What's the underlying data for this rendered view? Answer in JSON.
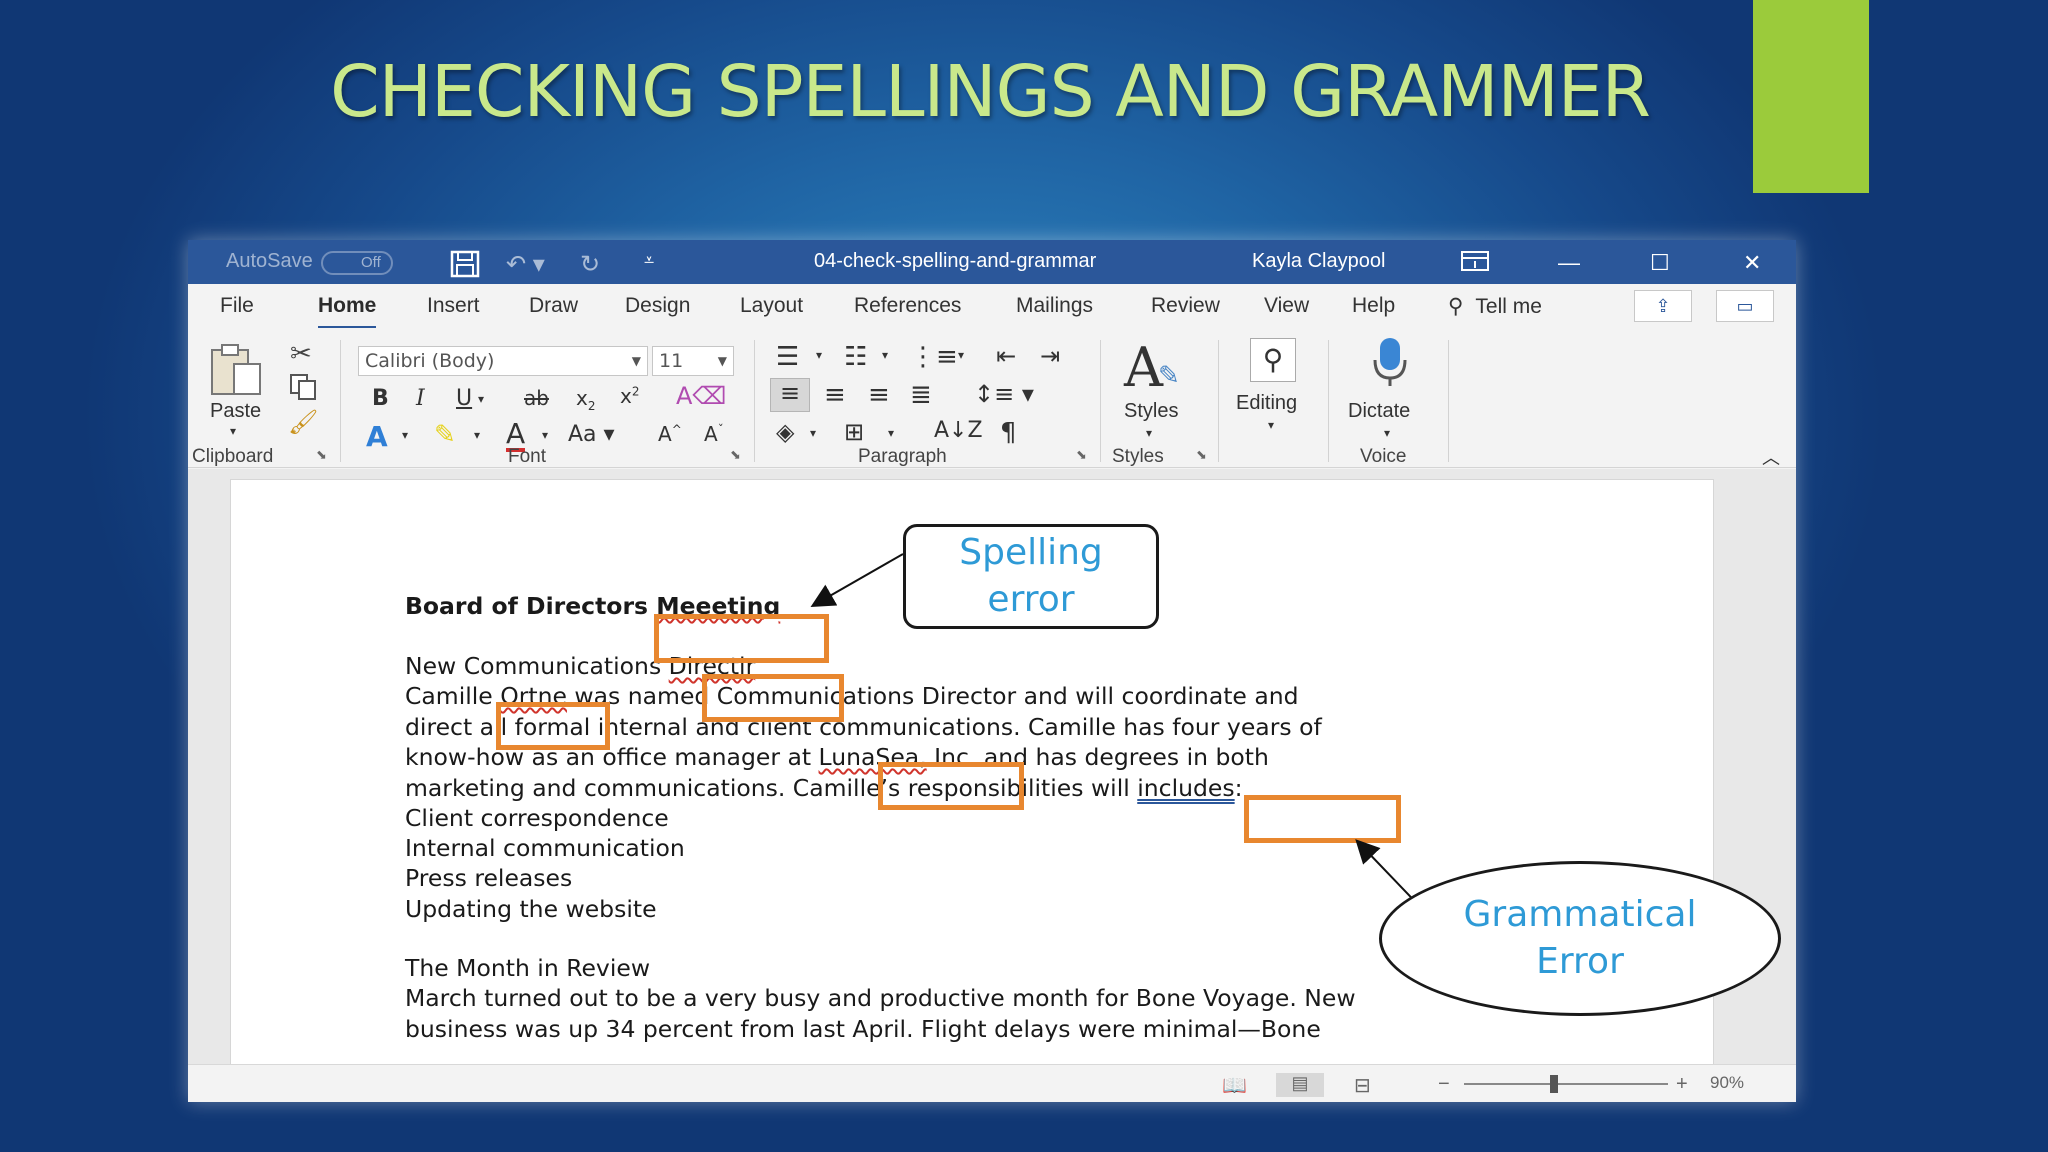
{
  "slide": {
    "title": "CHECKING SPELLINGS AND GRAMMER",
    "colors": {
      "title": "#c9e88b",
      "accent_bar": "#9bcb3b",
      "background": "#1f5fa0"
    }
  },
  "word": {
    "titlebar": {
      "autosave_label": "AutoSave",
      "autosave_state": "Off",
      "document_title": "04-check-spelling-and-grammar",
      "user_name": "Kayla Claypool"
    },
    "tabs": [
      "File",
      "Home",
      "Insert",
      "Draw",
      "Design",
      "Layout",
      "References",
      "Mailings",
      "Review",
      "View",
      "Help"
    ],
    "tell_me": "Tell me",
    "ribbon": {
      "clipboard": {
        "paste": "Paste",
        "group": "Clipboard"
      },
      "font": {
        "name": "Calibri (Body)",
        "size": "11",
        "case": "Aa",
        "group": "Font"
      },
      "paragraph": {
        "group": "Paragraph"
      },
      "styles": {
        "label": "Styles",
        "group": "Styles"
      },
      "editing": {
        "label": "Editing"
      },
      "voice": {
        "label": "Dictate",
        "group": "Voice"
      }
    },
    "document": {
      "heading_prefix": "Board of Director",
      "heading_error": "Meeeting",
      "sub_prefix": "New Communication",
      "sub_error": "Directir",
      "line1_a": "Camille ",
      "line1_error": "Ortne",
      "line1_b": " was named Communications Director and will coordinate and",
      "line2": "direct all formal internal and client communications. Camille has four years of",
      "line3_a": "know-how as an office manager at ",
      "line3_error": "LunaSea,",
      "line3_b": " Inc. and has degrees in both",
      "line4_a": "marketing and communications. Camille’s responsibilities will ",
      "line4_error": "includes",
      "line4_b": ":",
      "items": [
        "Client correspondence",
        "Internal communication",
        "Press releases",
        "Updating the website"
      ],
      "section_heading": "The Month in Review",
      "para1": "March turned out to be a very busy and productive month for Bone Voyage. New",
      "para2": "business was up 34 percent from last April. Flight delays were minimal—Bone"
    },
    "statusbar": {
      "zoom": "90%"
    }
  },
  "callouts": {
    "spelling": "Spelling\nerror",
    "grammar": "Grammatical\nError",
    "color_text": "#2e9ad6",
    "color_box": "#e8872f"
  }
}
